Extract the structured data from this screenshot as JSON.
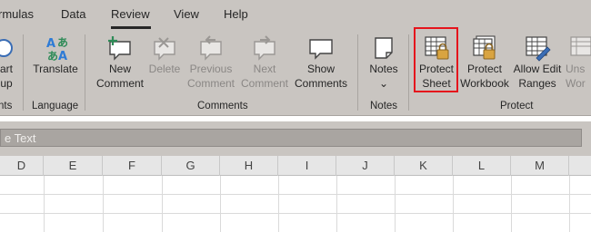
{
  "tabs": [
    {
      "label": "rmulas",
      "active": false
    },
    {
      "label": "Data",
      "active": false
    },
    {
      "label": "Review",
      "active": true
    },
    {
      "label": "View",
      "active": false
    },
    {
      "label": "Help",
      "active": false
    }
  ],
  "ribbon": {
    "partial_left": {
      "line1": "art",
      "line2": "up",
      "group": "nts"
    },
    "translate": {
      "label": "Translate",
      "group": "Language"
    },
    "comments": {
      "new": {
        "line1": "New",
        "line2": "Comment"
      },
      "delete": {
        "line1": "Delete",
        "line2": ""
      },
      "previous": {
        "line1": "Previous",
        "line2": "Comment"
      },
      "next": {
        "line1": "Next",
        "line2": "Comment"
      },
      "show": {
        "line1": "Show",
        "line2": "Comments"
      },
      "group": "Comments"
    },
    "notes": {
      "line1": "Notes",
      "line2": "⌄",
      "group": "Notes"
    },
    "protect": {
      "sheet": {
        "line1": "Protect",
        "line2": "Sheet"
      },
      "workbook": {
        "line1": "Protect",
        "line2": "Workbook"
      },
      "ranges": {
        "line1": "Allow Edit",
        "line2": "Ranges"
      },
      "unshare": {
        "line1": "Uns",
        "line2": "Wor"
      },
      "group": "Protect"
    }
  },
  "formula_bar": {
    "text": "e Text"
  },
  "columns": [
    "D",
    "E",
    "F",
    "G",
    "H",
    "I",
    "J",
    "K",
    "L",
    "M"
  ],
  "colors": {
    "ribbon": "#c9c5c1",
    "highlight": "#e5141c",
    "accent_green": "#2e8b57"
  }
}
